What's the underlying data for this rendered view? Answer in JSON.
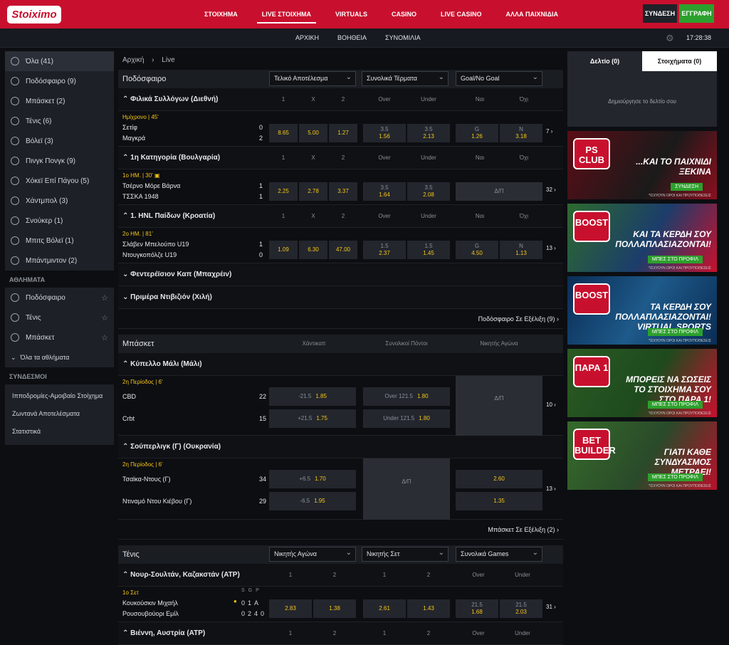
{
  "header": {
    "logo": "Stoiximo",
    "nav": [
      "ΣΤΟΙΧΗΜΑ",
      "LIVE ΣΤΟΙΧΗΜΑ",
      "VIRTUALS",
      "CASINO",
      "LIVE CASINO",
      "ΑΛΛΑ ΠΑΙΧΝΙΔΙΑ"
    ],
    "login": "ΣΥΝΔΕΣΗ",
    "register": "ΕΓΓΡΑΦΗ"
  },
  "subnav": {
    "items": [
      "ΑΡΧΙΚΗ",
      "ΒΟΗΘΕΙΑ",
      "ΣΥΝΟΜΙΛΙΑ"
    ],
    "time": "17:28:38"
  },
  "sidebar": {
    "sports": [
      "Όλα (41)",
      "Ποδόσφαιρο (9)",
      "Μπάσκετ (2)",
      "Τένις (6)",
      "Βόλεϊ (3)",
      "Πινγκ Πονγκ (9)",
      "Χόκεϊ Επί Πάγου (5)",
      "Χάντμπολ (3)",
      "Σνούκερ (1)",
      "Μπιτς Βόλεϊ (1)",
      "Μπάντμιντον (2)"
    ],
    "fav_header": "ΑΘΛΗΜΑΤΑ",
    "favs": [
      "Ποδόσφαιρο",
      "Τένις",
      "Μπάσκετ"
    ],
    "all_sports": "Όλα τα αθλήματα",
    "links_header": "ΣΥΝΔΕΣΜΟΙ",
    "links": [
      "Ιπποδρομίες-Αμοιβαίο Στοίχημα",
      "Ζωντανά Αποτελέσματα",
      "Στατιστικά"
    ]
  },
  "breadcrumb": {
    "home": "Αρχική",
    "sep": "›",
    "current": "Live"
  },
  "football": {
    "title": "Ποδόσφαιρο",
    "dd1": "Τελικό Αποτέλεσμα",
    "dd2": "Συνολικά Τέρματα",
    "dd3": "Goal/No Goal",
    "cols": [
      "1",
      "X",
      "2",
      "Over",
      "Under",
      "Ναι",
      "Όχι"
    ],
    "leagues": [
      {
        "name": "Φιλικά Συλλόγων (Διεθνή)",
        "time": "Ημίχρονο | 45'",
        "t1": "Σετίφ",
        "t2": "Μαγκρά",
        "s1": "0",
        "s2": "2",
        "o1": "8.65",
        "ox": "5.00",
        "o2": "1.27",
        "ovl": "3.5",
        "ov": "1.56",
        "unl": "3.5",
        "un": "2.13",
        "ggl": "G",
        "gg": "1.26",
        "ngl": "N",
        "ng": "3.18",
        "more": "7"
      },
      {
        "name": "1η Κατηγορία (Βουλγαρία)",
        "time": "1ο ΗΜ. | 30'",
        "t1": "Τσέρνο Μόρε Βάρνα",
        "t2": "ΤΣΣΚΑ 1948",
        "s1": "1",
        "s2": "1",
        "o1": "2.25",
        "ox": "2.78",
        "o2": "3.37",
        "ovl": "3.5",
        "ov": "1.64",
        "unl": "3.5",
        "un": "2.08",
        "lock": "Δ/Π",
        "more": "32"
      },
      {
        "name": "1. HNL Παίδων (Κροατία)",
        "time": "2ο ΗΜ. | 81'",
        "t1": "Σλάβεν Μπελούπο U19",
        "t2": "Ντουγκοπόλζε U19",
        "s1": "1",
        "s2": "0",
        "o1": "1.09",
        "ox": "6.30",
        "o2": "47.00",
        "ovl": "1.5",
        "ov": "2.37",
        "unl": "1.5",
        "un": "1.45",
        "ggl": "G",
        "gg": "4.50",
        "ngl": "N",
        "ng": "1.13",
        "more": "13"
      }
    ],
    "collapsed": [
      "Φεντερέϊσιον Καπ (Μπαχρέιν)",
      "Πριμέρα Ντιβιζιόν (Χιλή)"
    ],
    "footer": "Ποδόσφαιρο Σε Εξέλιξη (9)"
  },
  "basket": {
    "title": "Μπάσκετ",
    "cols": [
      "Χάντικαπ",
      "Συνολικοί Πόντοι",
      "Νικητής Αγώνα"
    ],
    "l1": {
      "name": "Κύπελλο Μάλι (Μάλι)",
      "time": "2η Περίοδος | 6'",
      "t1": "CBD",
      "t2": "Crbt",
      "s1": "22",
      "s2": "15",
      "h1l": "-21.5",
      "h1": "1.85",
      "h2l": "+21.5",
      "h2": "1.75",
      "p1l": "Over 121.5",
      "p1": "1.80",
      "p2l": "Under 121.5",
      "p2": "1.80",
      "lock": "Δ/Π",
      "more": "10"
    },
    "l2": {
      "name": "Σούπερλιγκ (Γ) (Ουκρανία)",
      "time": "2η Περίοδος | 6'",
      "t1": "Τσαϊκα-Ντους (Γ)",
      "t2": "Ντιναμό Ντου Κιέβου (Γ)",
      "s1": "34",
      "s2": "29",
      "h1l": "+6.5",
      "h1": "1.70",
      "h2l": "-6.5",
      "h2": "1.95",
      "lock": "Δ/Π",
      "w1": "2.60",
      "w2": "1.35",
      "more": "13"
    },
    "footer": "Μπάσκετ Σε Εξέλιξη (2)"
  },
  "tennis": {
    "title": "Τένις",
    "dd1": "Νικητής Αγώνα",
    "dd2": "Νικητής Σετ",
    "dd3": "Συνολικά Games",
    "cols": [
      "1",
      "2",
      "1",
      "2",
      "Over",
      "Under"
    ],
    "l1": {
      "name": "Νουρ-Σουλτάν, Καζακστάν (ATP)",
      "time": "1ο Σετ",
      "sgp": [
        "S",
        "G",
        "P"
      ],
      "t1": "Κουκούσκιν Μιχαήλ",
      "t2": "Ρουσουβούορι Εμίλ",
      "r1": [
        "0",
        "1",
        "A"
      ],
      "r2": [
        "0",
        "2",
        "40"
      ],
      "a1": "2.83",
      "a2": "1.38",
      "b1": "2.61",
      "b2": "1.43",
      "ovl": "21.5",
      "ov": "1.68",
      "unl": "21.5",
      "un": "2.03",
      "more": "31"
    },
    "l2": {
      "name": "Βιέννη, Αυστρία (ATP)"
    }
  },
  "betslip": {
    "tab1": "Δελτίο (0)",
    "tab2": "Στοιχήματα (0)",
    "empty": "Δημιούργησε το δελτίο σου"
  },
  "banners": [
    {
      "badge": "PS CLUB",
      "text": "...ΚΑΙ ΤΟ ΠΑΙΧΝΙΔΙ ΞΕΚΙΝΑ",
      "cta": "ΣΥΝΔΕΣΗ",
      "small": "*ΙΣΧΥΟΥΝ ΟΡΟΙ ΚΑΙ ΠΡΟΥΠΟΘΕΣΕΙΣ",
      "bg": "#3a0a10"
    },
    {
      "badge": "BOOST",
      "text": "ΚΑΙ ΤΑ ΚΕΡΔΗ ΣΟΥ ΠΟΛΛΑΠΛΑΣΙΑΖΟΝΤΑΙ!",
      "cta": "ΜΠΕΣ ΣΤΟ ΠΡΟΦΙΛ",
      "small": "*ΙΣΧΥΟΥΝ ΟΡΟΙ ΚΑΙ ΠΡΟΥΠΟΘΕΣΕΙΣ",
      "bg": "#1e4a1e"
    },
    {
      "badge": "BOOST",
      "text": "ΤΑ ΚΕΡΔΗ ΣΟΥ ΠΟΛΛΑΠΛΑΣΙΑΖΟΝΤΑΙ! VIRTUAL SPORTS",
      "cta": "ΜΠΕΣ ΣΤΟ ΠΡΟΦΙΛ",
      "small": "*ΙΣΧΥΟΥΝ ΟΡΟΙ ΚΑΙ ΠΡΟΥΠΟΘΕΣΕΙΣ",
      "bg": "#0b2a4a"
    },
    {
      "badge": "ΠΑΡΑ 1",
      "text": "ΜΠΟΡΕΙΣ ΝΑ ΣΩΣΕΙΣ ΤΟ ΣΤΟΙΧΗΜΑ ΣΟΥ ΣΤΟ ΠΑΡΑ 1!",
      "cta": "ΜΠΕΣ ΣΤΟ ΠΡΟΦΙΛ",
      "small": "*ΙΣΧΥΟΥΝ ΟΡΟΙ ΚΑΙ ΠΡΟΥΠΟΘΕΣΕΙΣ",
      "bg": "#1e4a1e"
    },
    {
      "badge": "BET BUILDER",
      "text": "ΓΙΑΤΙ ΚΑΘΕ ΣΥΝΔΥΑΣΜΟΣ ΜΕΤΡΑΕΙ!",
      "cta": "ΜΠΕΣ ΣΤΟ ΠΡΟΦΙΛ",
      "small": "*ΙΣΧΥΟΥΝ ΟΡΟΙ ΚΑΙ ΠΡΟΥΠΟΘΕΣΕΙΣ",
      "bg": "#2a4a2a"
    }
  ]
}
